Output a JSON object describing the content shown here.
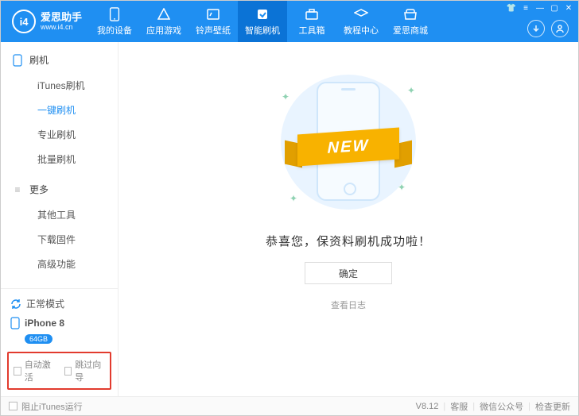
{
  "brand": {
    "logo_text": "i4",
    "name": "爱思助手",
    "domain": "www.i4.cn"
  },
  "nav": [
    {
      "key": "devices",
      "label": "我的设备"
    },
    {
      "key": "games",
      "label": "应用游戏"
    },
    {
      "key": "ringtones",
      "label": "铃声壁纸"
    },
    {
      "key": "flash",
      "label": "智能刷机"
    },
    {
      "key": "toolbox",
      "label": "工具箱"
    },
    {
      "key": "tutorial",
      "label": "教程中心"
    },
    {
      "key": "store",
      "label": "爱思商城"
    }
  ],
  "sidebar": {
    "flash_group": "刷机",
    "flash_items": [
      "iTunes刷机",
      "一键刷机",
      "专业刷机",
      "批量刷机"
    ],
    "more_group": "更多",
    "more_items": [
      "其他工具",
      "下载固件",
      "高级功能"
    ]
  },
  "device": {
    "mode": "正常模式",
    "name": "iPhone 8",
    "storage": "64GB"
  },
  "checkboxes": {
    "auto_activate": "自动激活",
    "skip_setup": "跳过向导"
  },
  "main": {
    "banner": "NEW",
    "message": "恭喜您，保资料刷机成功啦！",
    "ok": "确定",
    "view_log": "查看日志"
  },
  "footer": {
    "block_itunes": "阻止iTunes运行",
    "version": "V8.12",
    "support": "客服",
    "wechat": "微信公众号",
    "check_update": "检查更新"
  }
}
